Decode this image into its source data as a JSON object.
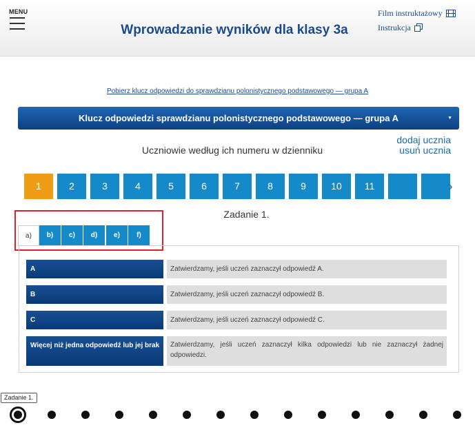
{
  "header": {
    "menu_label": "MENU",
    "title": "Wprowadzanie wyników dla klasy 3a",
    "film_link": "Film instruktażowy",
    "instruction_link": "Instrukcja"
  },
  "download_link": "Pobierz klucz odpowiedzi do sprawdzianu polonistycznego podstawowego — grupa A",
  "key_select": {
    "selected": "Klucz odpowiedzi sprawdzianu polonistycznego podstawowego — grupa A"
  },
  "students": {
    "label": "Uczniowie według ich numeru w dzienniku",
    "add_label": "dodaj ucznia",
    "remove_label": "usuń ucznia",
    "numbers": [
      "1",
      "2",
      "3",
      "4",
      "5",
      "6",
      "7",
      "8",
      "9",
      "10",
      "11",
      "",
      ""
    ],
    "active_index": 0,
    "next_arrow": "›"
  },
  "task": {
    "title": "Zadanie 1.",
    "subtabs": [
      "a)",
      "b)",
      "c)",
      "d)",
      "e)",
      "f)"
    ],
    "active_subtab": 0
  },
  "answers": [
    {
      "label": "A",
      "description": "Zatwierdzamy, jeśli uczeń zaznaczył odpowiedź A."
    },
    {
      "label": "B",
      "description": "Zatwierdzamy, jeśli uczeń zaznaczył odpowiedź B."
    },
    {
      "label": "C",
      "description": "Zatwierdzamy, jeśli uczeń zaznaczył odpowiedź C."
    },
    {
      "label": "Więcej niż jedna odpowiedź lub jej brak",
      "description": "Zatwierdzamy, jeśli uczeń zaznaczył kilka odpowiedzi lub nie zaznaczył żadnej odpowiedzi."
    }
  ],
  "pager": {
    "tooltip": "Zadanie 1.",
    "count": 14,
    "active_index": 0
  },
  "colors": {
    "accent": "#1689c9",
    "active_number": "#f09d16",
    "title_blue": "#1a4a8c",
    "highlight_red": "#d9232e"
  }
}
